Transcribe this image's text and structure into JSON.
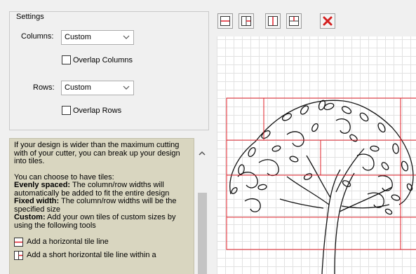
{
  "settings": {
    "group_title": "Settings",
    "columns_label": "Columns:",
    "columns_value": "Custom",
    "overlap_columns_label": "Overlap Columns",
    "overlap_columns_checked": false,
    "rows_label": "Rows:",
    "rows_value": "Custom",
    "overlap_rows_label": "Overlap Rows",
    "overlap_rows_checked": false
  },
  "help": {
    "intro": "If your design is wider than the maximum cutting with of your cutter, you can break up your design into tiles.",
    "choose": "You can choose to have tiles:",
    "evenly_title": "Evenly spaced:",
    "evenly_text": " The column/row widths will automatically be added to fit the entire design",
    "fixed_title": "Fixed width:",
    "fixed_text": " The column/row widths will be the specified size",
    "custom_title": "Custom:",
    "custom_text": " Add your own tiles of custom sizes by using the following tools",
    "tool_horizontal": "Add a horizontal tile line",
    "tool_short_horizontal": "Add a short horizontal tile line within a"
  },
  "toolbar": {
    "icons": [
      "horizontal-line-icon",
      "short-horizontal-line-icon",
      "vertical-line-icon",
      "short-vertical-line-icon",
      "delete-icon"
    ]
  },
  "colors": {
    "tile_line": "#e0202a",
    "delete": "#d42020",
    "help_bg": "#d9d6c0"
  }
}
